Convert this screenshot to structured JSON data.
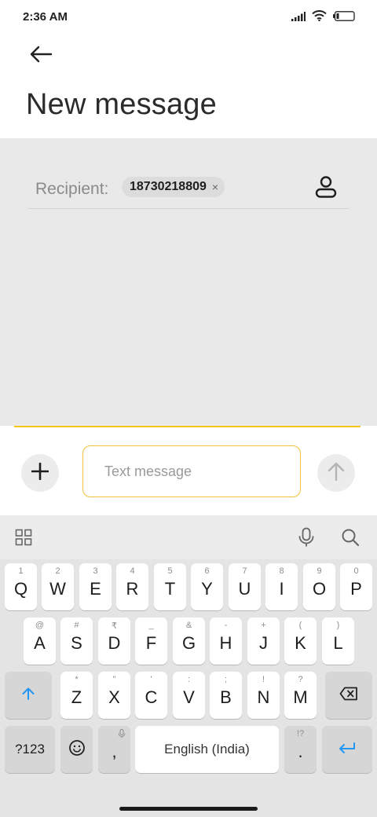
{
  "status_bar": {
    "time": "2:36 AM",
    "icons": [
      "signal-icon",
      "wifi-icon",
      "battery-icon"
    ]
  },
  "header": {
    "title": "New message",
    "back_icon": "back-arrow-icon"
  },
  "recipient": {
    "label": "Recipient:",
    "chip_value": "18730218809",
    "chip_close": "×",
    "contact_icon": "contact-person-icon"
  },
  "compose": {
    "placeholder": "Text message",
    "add_icon": "plus-icon",
    "send_icon": "send-arrow-icon"
  },
  "colors": {
    "accent": "#f5c518",
    "field_border": "#f0c23a",
    "content_bg": "#e9e9e9",
    "keyboard_bg": "#e4e4e4",
    "enter_blue": "#2196f3"
  },
  "keyboard": {
    "toolbar_icons": [
      "grid-apps-icon",
      "microphone-icon",
      "search-icon"
    ],
    "row1": [
      {
        "label": "Q",
        "hint": "1"
      },
      {
        "label": "W",
        "hint": "2"
      },
      {
        "label": "E",
        "hint": "3"
      },
      {
        "label": "R",
        "hint": "4"
      },
      {
        "label": "T",
        "hint": "5"
      },
      {
        "label": "Y",
        "hint": "6"
      },
      {
        "label": "U",
        "hint": "7"
      },
      {
        "label": "I",
        "hint": "8"
      },
      {
        "label": "O",
        "hint": "9"
      },
      {
        "label": "P",
        "hint": "0"
      }
    ],
    "row2": [
      {
        "label": "A",
        "hint": "@"
      },
      {
        "label": "S",
        "hint": "#"
      },
      {
        "label": "D",
        "hint": "₹"
      },
      {
        "label": "F",
        "hint": "_"
      },
      {
        "label": "G",
        "hint": "&"
      },
      {
        "label": "H",
        "hint": "-"
      },
      {
        "label": "J",
        "hint": "+"
      },
      {
        "label": "K",
        "hint": "("
      },
      {
        "label": "L",
        "hint": ")"
      }
    ],
    "row3": [
      {
        "label": "Z",
        "hint": "*"
      },
      {
        "label": "X",
        "hint": "\""
      },
      {
        "label": "C",
        "hint": "'"
      },
      {
        "label": "V",
        "hint": ":"
      },
      {
        "label": "B",
        "hint": ";"
      },
      {
        "label": "N",
        "hint": "!"
      },
      {
        "label": "M",
        "hint": "?"
      }
    ],
    "row4": {
      "symbols": "?123",
      "comma": ",",
      "space": "English (India)",
      "period": ".",
      "period_hint": "!?"
    }
  }
}
